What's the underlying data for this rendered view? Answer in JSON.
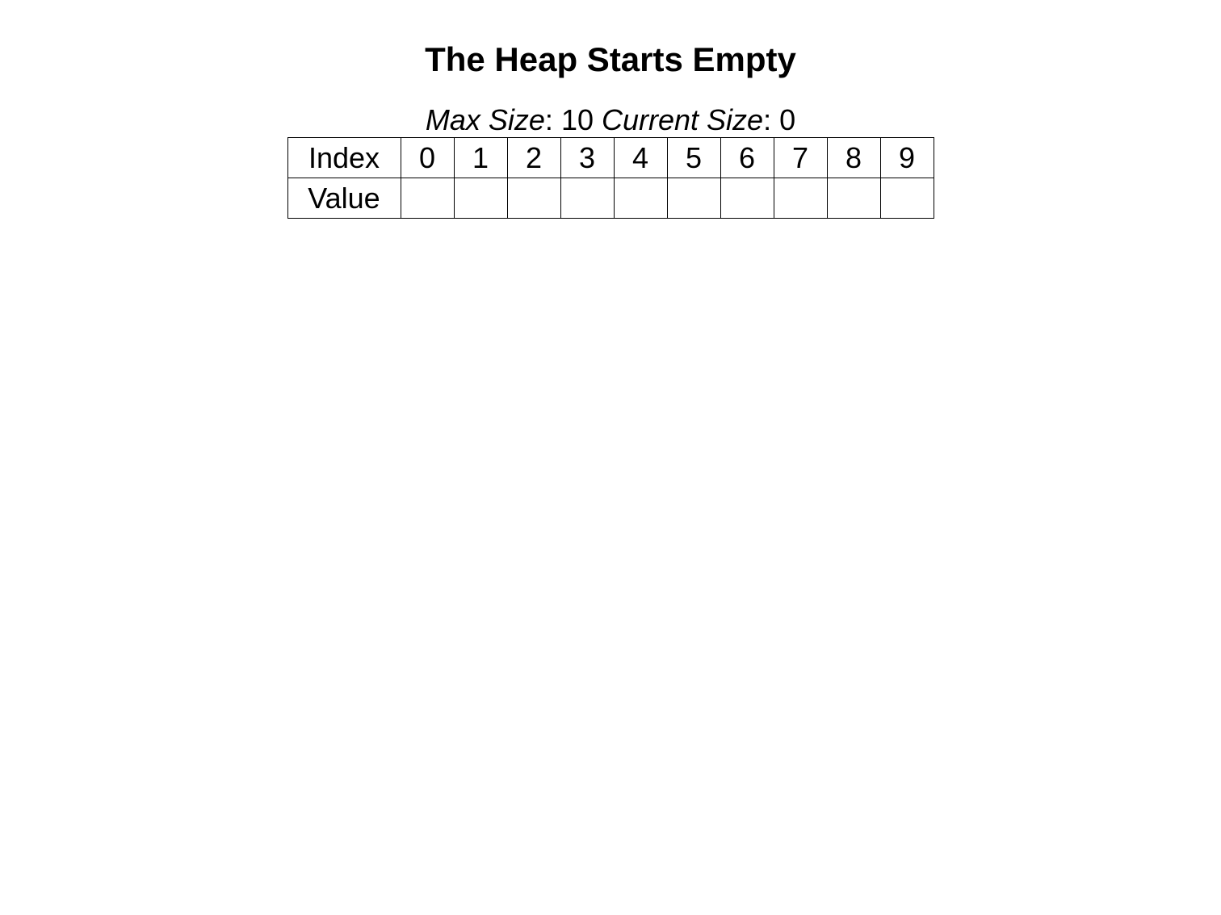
{
  "title": "The Heap Starts Empty",
  "sizeInfo": {
    "maxSizeLabel": "Max Size",
    "maxSizeValue": "10",
    "currentSizeLabel": "Current Size",
    "currentSizeValue": "0"
  },
  "table": {
    "indexLabel": "Index",
    "valueLabel": "Value",
    "indices": [
      "0",
      "1",
      "2",
      "3",
      "4",
      "5",
      "6",
      "7",
      "8",
      "9"
    ],
    "values": [
      "",
      "",
      "",
      "",
      "",
      "",
      "",
      "",
      "",
      ""
    ]
  }
}
